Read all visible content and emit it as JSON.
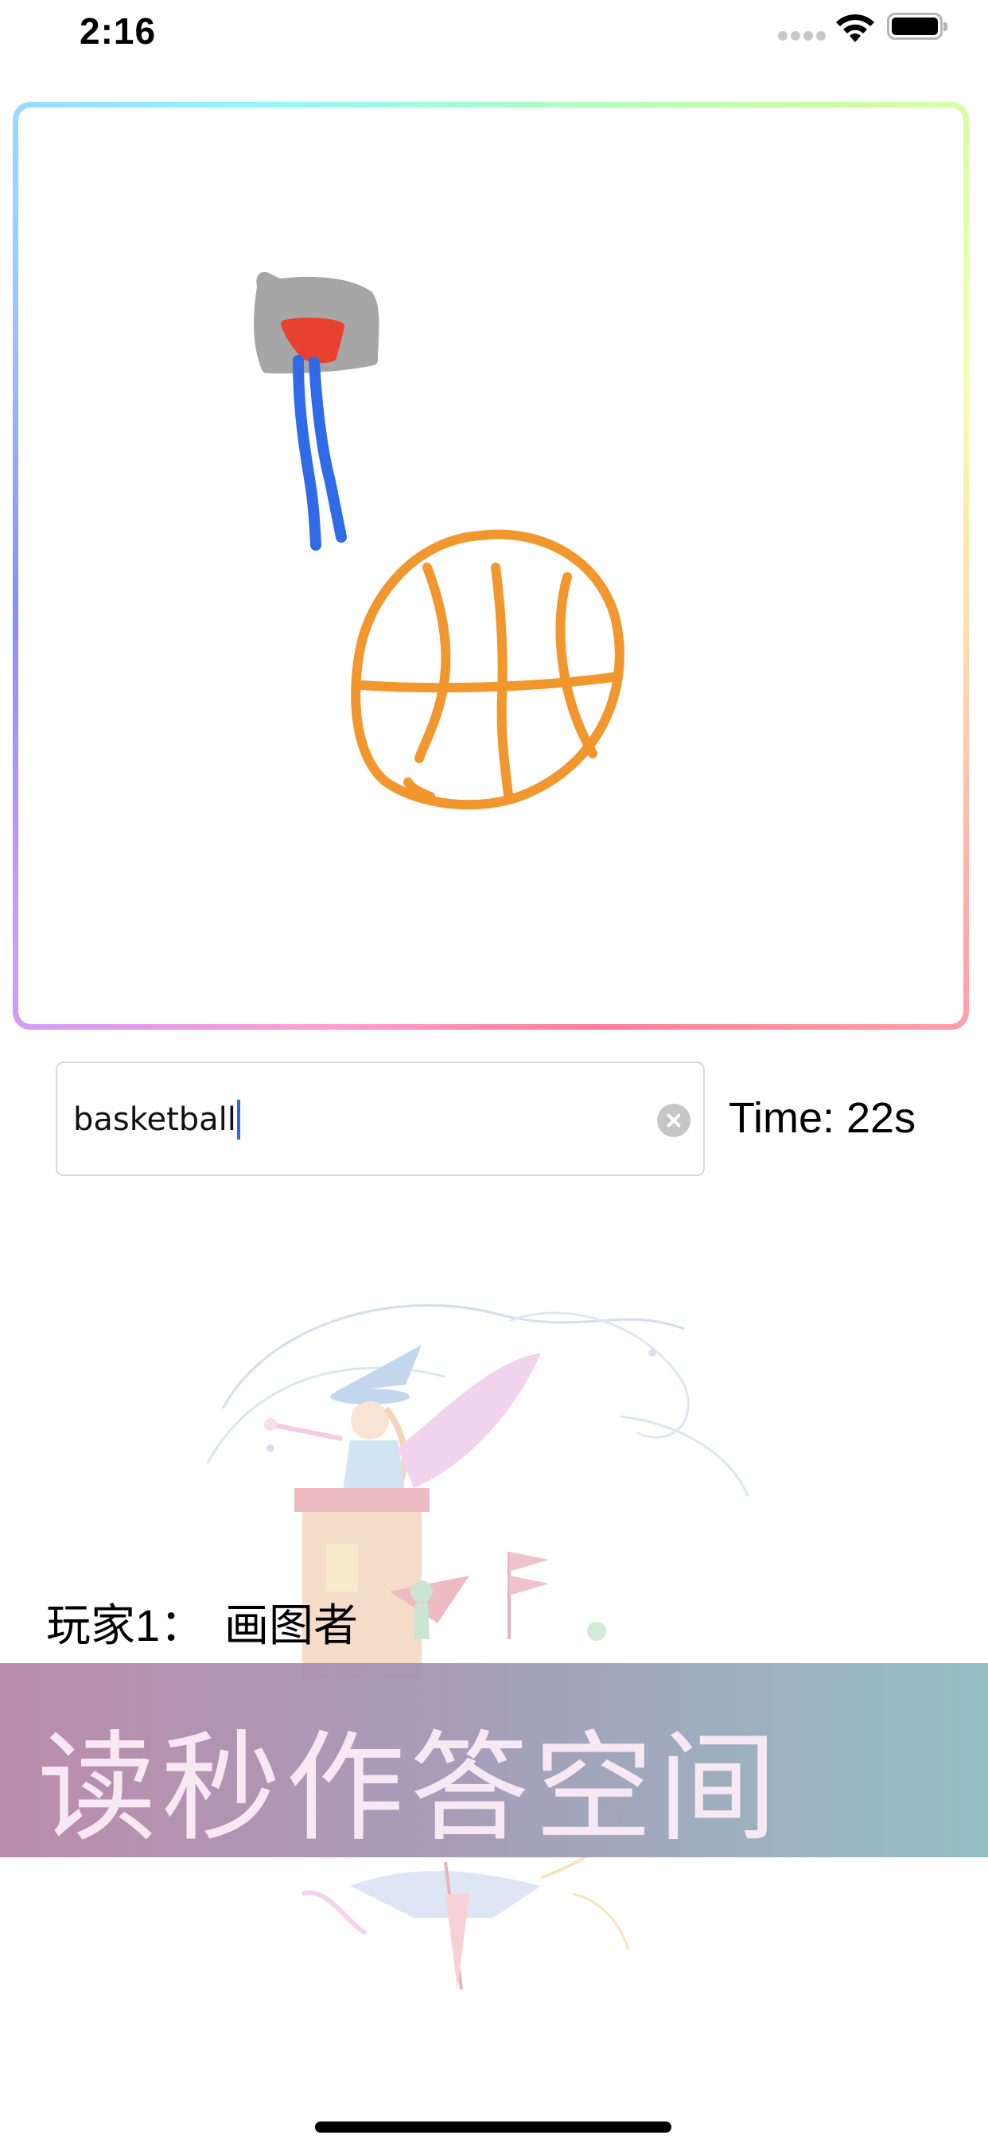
{
  "status_bar": {
    "time": "2:16"
  },
  "answer_input": {
    "value": "basketball"
  },
  "timer": {
    "text": "Time: 22s"
  },
  "player": {
    "label": "玩家1：",
    "role": "画图者"
  },
  "banner": {
    "text": "读秒作答空间"
  },
  "colors": {
    "caret": "#2f63e8",
    "stroke_gray": "#a6a6a6",
    "stroke_red": "#e8412f",
    "stroke_blue": "#2f6be6",
    "stroke_orange": "#f2962e"
  }
}
